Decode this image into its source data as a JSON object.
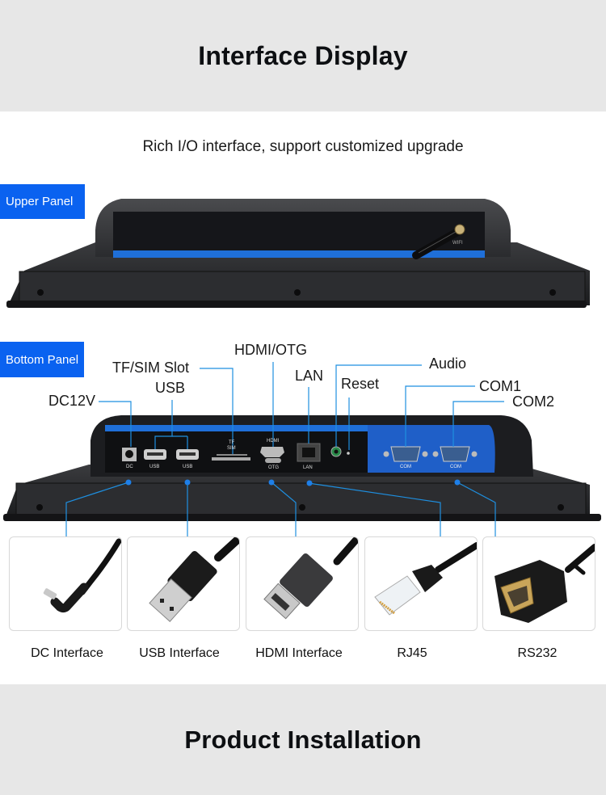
{
  "header": {
    "title": "Interface Display"
  },
  "subtitle": "Rich I/O interface, support customized upgrade",
  "upper_panel": {
    "tag": "Upper Panel",
    "antenna_label": "WIFI"
  },
  "bottom_panel": {
    "tag": "Bottom Panel",
    "callouts": {
      "dc": "DC12V",
      "usb": "USB",
      "tf_sim": "TF/SIM Slot",
      "hdmi_otg": "HDMI/OTG",
      "lan": "LAN",
      "reset": "Reset",
      "audio": "Audio",
      "com1": "COM1",
      "com2": "COM2"
    },
    "port_labels": {
      "dc": "DC",
      "usb1": "USB",
      "usb2": "USB",
      "tf": "TF",
      "sim": "SIM",
      "hdmi": "HDMI",
      "otg": "OTG",
      "lan": "LAN",
      "com1": "COM",
      "com2": "COM"
    }
  },
  "interfaces": [
    {
      "label": "DC Interface",
      "icon": "dc-plug-icon"
    },
    {
      "label": "USB Interface",
      "icon": "usb-plug-icon"
    },
    {
      "label": "HDMI Interface",
      "icon": "hdmi-plug-icon"
    },
    {
      "label": "RJ45",
      "icon": "rj45-plug-icon"
    },
    {
      "label": "RS232",
      "icon": "rs232-plug-icon"
    }
  ],
  "footer": {
    "title": "Product Installation"
  },
  "colors": {
    "accent_blue": "#0a62f0",
    "callout_line": "#1e8fe0",
    "banner_bg": "#e7e7e7",
    "device_body": "#1c1d20",
    "device_stripe": "#1f6fd8"
  }
}
